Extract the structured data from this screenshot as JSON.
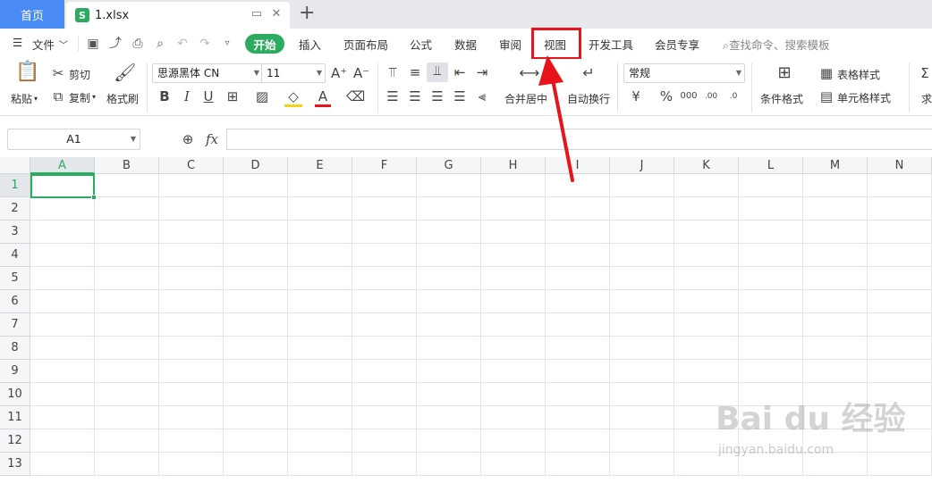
{
  "titlebar": {
    "home_tab": "首页",
    "file_icon": "S",
    "file_name": "1.xlsx"
  },
  "menubar": {
    "file_menu": "文件",
    "tabs": [
      "开始",
      "插入",
      "页面布局",
      "公式",
      "数据",
      "审阅",
      "视图",
      "开发工具",
      "会员专享"
    ],
    "search_placeholder": "查找命令、搜索模板"
  },
  "ribbon": {
    "paste": "粘贴",
    "cut": "剪切",
    "copy": "复制",
    "format_painter": "格式刷",
    "font_name": "思源黑体 CN",
    "font_size": "11",
    "merge_center": "合并居中",
    "wrap_text": "自动换行",
    "number_format": "常规",
    "conditional_format": "条件格式",
    "table_style": "表格样式",
    "cell_style": "单元格样式",
    "sum_partial": "求"
  },
  "formulabar": {
    "name_box": "A1",
    "fx_label": "fx"
  },
  "grid": {
    "columns": [
      "A",
      "B",
      "C",
      "D",
      "E",
      "F",
      "G",
      "H",
      "I",
      "J",
      "K",
      "L",
      "M",
      "N"
    ],
    "rows": [
      "1",
      "2",
      "3",
      "4",
      "5",
      "6",
      "7",
      "8",
      "9",
      "10",
      "11",
      "12",
      "13"
    ],
    "selected_cell": "A1"
  },
  "watermark": {
    "text": "Bai du 经验",
    "url": "jingyan.baidu.com"
  },
  "colors": {
    "accent_green": "#2bab5f",
    "home_blue": "#4a8af4",
    "annotation_red": "#e8141b"
  }
}
